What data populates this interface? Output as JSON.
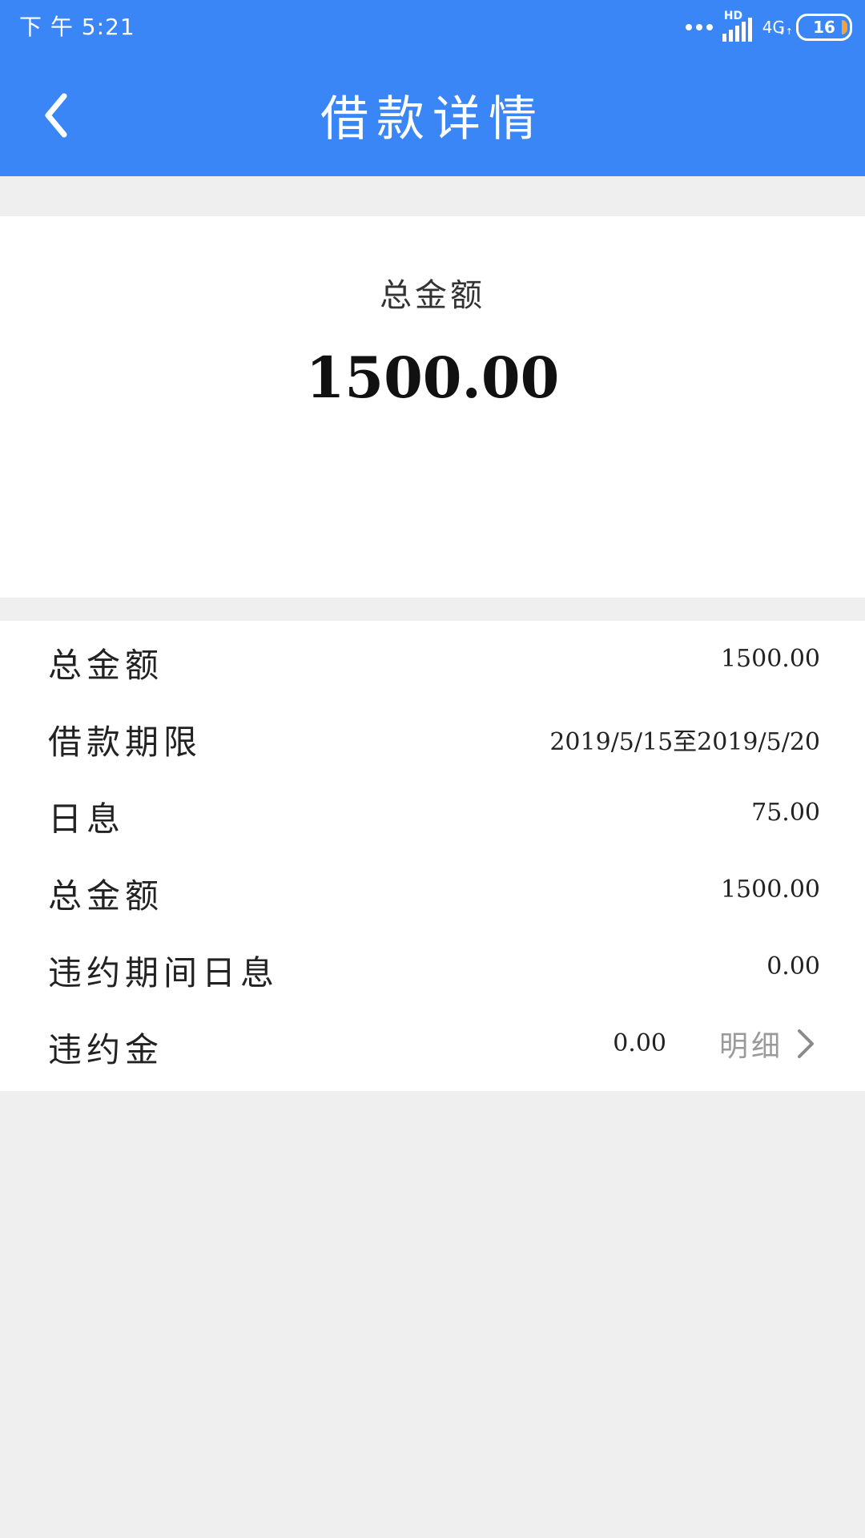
{
  "status_bar": {
    "time": "下 午 5:21",
    "hd": "HD",
    "network": "4G",
    "battery": "16",
    "battery_color": "#f2a33a"
  },
  "header": {
    "title": "借款详情",
    "back_icon": "chevron-left-icon",
    "bg_color": "#3a86f6"
  },
  "summary": {
    "label": "总金额",
    "amount": "1500.00"
  },
  "details": {
    "rows": [
      {
        "label": "总金额",
        "value": "1500.00"
      },
      {
        "label": "借款期限",
        "value": "2019/5/15至2019/5/20"
      },
      {
        "label": "日息",
        "value": "75.00"
      },
      {
        "label": "总金额",
        "value": "1500.00"
      },
      {
        "label": "违约期间日息",
        "value": "0.00"
      },
      {
        "label": "违约金",
        "value": "0.00",
        "link_label": "明细",
        "link_icon": "chevron-right-icon"
      }
    ]
  }
}
